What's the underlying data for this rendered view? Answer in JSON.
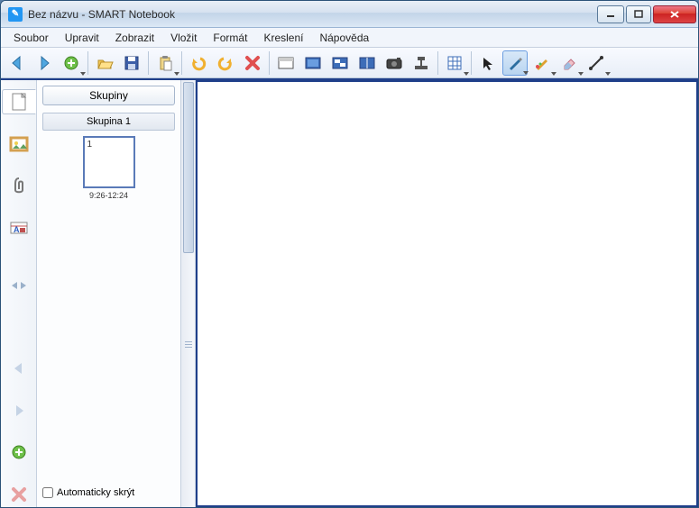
{
  "window": {
    "title": "Bez názvu - SMART Notebook"
  },
  "menu": {
    "items": [
      "Soubor",
      "Upravit",
      "Zobrazit",
      "Vložit",
      "Formát",
      "Kreslení",
      "Nápověda"
    ]
  },
  "sidebar": {
    "groups_button": "Skupiny",
    "group_header": "Skupina 1",
    "page_number": "1",
    "page_time": "9:26-12:24",
    "autohide_label": "Automaticky skrýt"
  }
}
